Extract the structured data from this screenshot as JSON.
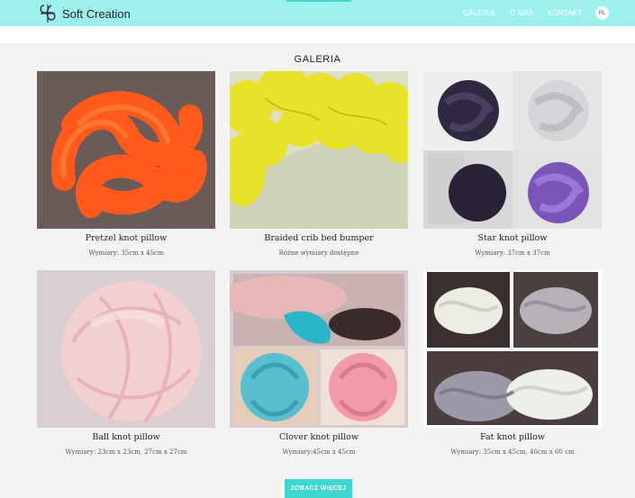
{
  "header": {
    "brand": "Soft Creation",
    "nav": [
      {
        "label": "GALERIA"
      },
      {
        "label": "O NAS"
      },
      {
        "label": "KONTAKT"
      }
    ],
    "lang": "PL",
    "accent": "#3fd6cf",
    "bar_color": "#9ef0ee"
  },
  "gallery": {
    "title": "GALERIA",
    "items": [
      {
        "name": "Pretzel knot pillow",
        "dims": "Wymiary: 35cm x 45cm"
      },
      {
        "name": "Braided crib bed bumper",
        "dims": "Różne wymiary dostępne"
      },
      {
        "name": "Star knot pillow",
        "dims": "Wymiary: 37cm x 37cm"
      },
      {
        "name": "Ball knot pillow",
        "dims": "Wymiary: 23cm x 23cm, 27cm x 27cm"
      },
      {
        "name": "Clover knot pillow",
        "dims": "Wymiary:45cm x 45cm"
      },
      {
        "name": "Fat knot pillow",
        "dims": "Wymiary: 35cm x 45cm, 40cm x 60 cm"
      }
    ],
    "more_button": "ZOBACZ WIĘCEJ"
  }
}
